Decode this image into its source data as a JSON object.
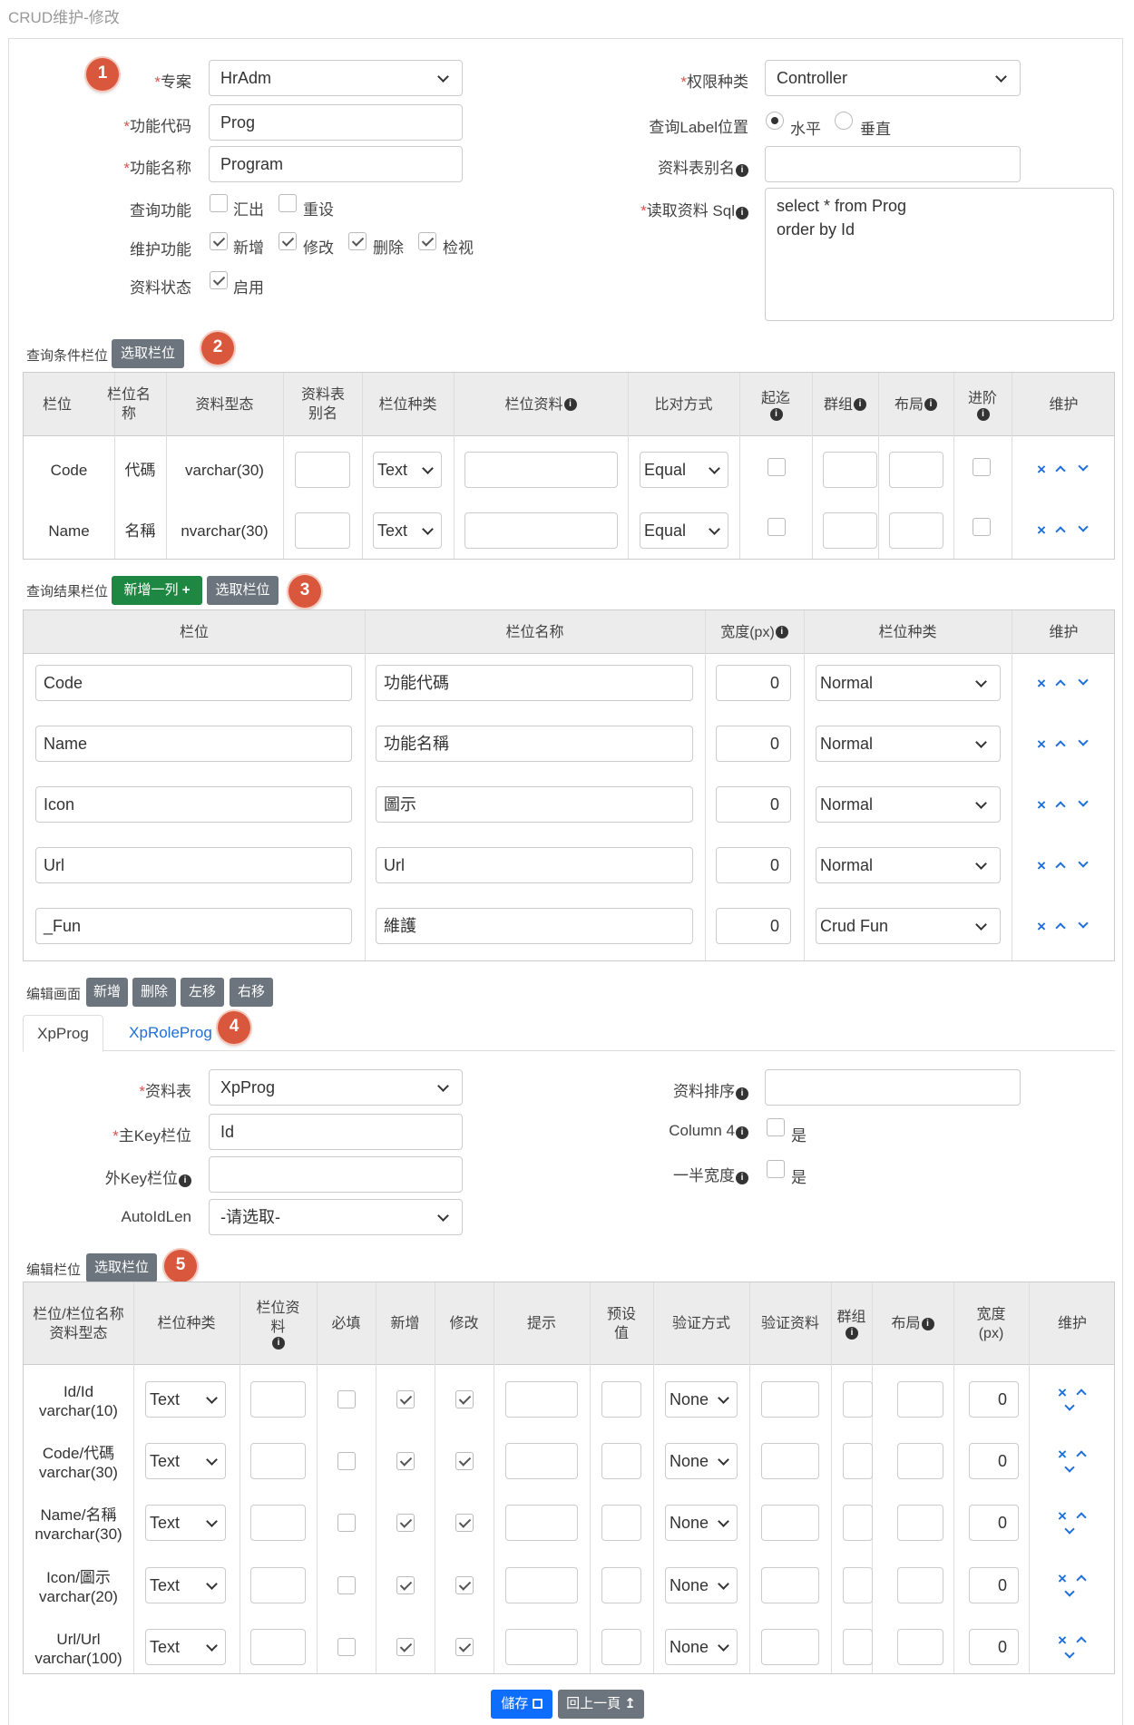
{
  "page_title": "CRUD维护-修改",
  "badges": [
    "1",
    "2",
    "3",
    "4",
    "5"
  ],
  "form": {
    "project": {
      "label": "专案",
      "value": "HrAdm"
    },
    "prog_code": {
      "label": "功能代码",
      "value": "Prog"
    },
    "prog_name": {
      "label": "功能名称",
      "value": "Program"
    },
    "query_func": {
      "label": "查询功能",
      "export": "汇出",
      "reset": "重设"
    },
    "maint_func": {
      "label": "维护功能",
      "add": "新增",
      "edit": "修改",
      "delete": "删除",
      "view": "检视"
    },
    "data_status": {
      "label": "资料状态",
      "enabled": "启用"
    },
    "auth_type": {
      "label": "权限种类",
      "value": "Controller"
    },
    "query_label_pos": {
      "label": "查询Label位置",
      "horizontal": "水平",
      "vertical": "垂直"
    },
    "table_alias": {
      "label": "资料表别名",
      "value": ""
    },
    "read_sql": {
      "label": "读取资料 Sql",
      "line1": "select * from Prog",
      "line2": "order by Id"
    }
  },
  "query_cond": {
    "label": "查询条件栏位",
    "pick_btn": "选取栏位",
    "headers": [
      "栏位",
      "栏位名称",
      "资料型态",
      "资料表别名",
      "栏位种类",
      "栏位资料",
      "比对方式",
      "起迄",
      "群组",
      "布局",
      "进阶",
      "维护"
    ],
    "rows": [
      {
        "field": "Code",
        "name": "代碼",
        "type": "varchar(30)",
        "kind": "Text",
        "op": "Equal"
      },
      {
        "field": "Name",
        "name": "名稱",
        "type": "nvarchar(30)",
        "kind": "Text",
        "op": "Equal"
      }
    ]
  },
  "query_result": {
    "label": "查询结果栏位",
    "add_btn": "新增一列",
    "pick_btn": "选取栏位",
    "headers": [
      "栏位",
      "栏位名称",
      "宽度(px)",
      "栏位种类",
      "维护"
    ],
    "rows": [
      {
        "field": "Code",
        "name": "功能代碼",
        "width": "0",
        "kind": "Normal"
      },
      {
        "field": "Name",
        "name": "功能名稱",
        "width": "0",
        "kind": "Normal"
      },
      {
        "field": "Icon",
        "name": "圖示",
        "width": "0",
        "kind": "Normal"
      },
      {
        "field": "Url",
        "name": "Url",
        "width": "0",
        "kind": "Normal"
      },
      {
        "field": "_Fun",
        "name": "維護",
        "width": "0",
        "kind": "Crud Fun"
      }
    ]
  },
  "edit_screen": {
    "label": "编辑画面",
    "add_btn": "新增",
    "delete_btn": "删除",
    "left_btn": "左移",
    "right_btn": "右移",
    "tabs": [
      "XpProg",
      "XpRoleProg"
    ],
    "table": {
      "label": "资料表",
      "value": "XpProg"
    },
    "pk": {
      "label": "主Key栏位",
      "value": "Id"
    },
    "fk": {
      "label": "外Key栏位",
      "value": ""
    },
    "auto_id": {
      "label": "AutoIdLen",
      "value": "-请选取-"
    },
    "sort": {
      "label": "资料排序",
      "value": ""
    },
    "col4": {
      "label": "Column 4",
      "yes": "是"
    },
    "half": {
      "label": "一半宽度",
      "yes": "是"
    }
  },
  "edit_fields": {
    "label": "编辑栏位",
    "pick_btn": "选取栏位",
    "headers": [
      "栏位/栏位名称",
      "资料型态",
      "栏位种类",
      "栏位资料",
      "必填",
      "新增",
      "修改",
      "提示",
      "预设值",
      "验证方式",
      "验证资料",
      "群组",
      "布局",
      "宽度(px)",
      "维护"
    ],
    "rows": [
      {
        "field": "Id/Id",
        "type": "varchar(10)",
        "kind": "Text",
        "valid": "None",
        "width": "0"
      },
      {
        "field": "Code/代碼",
        "type": "varchar(30)",
        "kind": "Text",
        "valid": "None",
        "width": "0"
      },
      {
        "field": "Name/名稱",
        "type": "nvarchar(30)",
        "kind": "Text",
        "valid": "None",
        "width": "0"
      },
      {
        "field": "Icon/圖示",
        "type": "varchar(20)",
        "kind": "Text",
        "valid": "None",
        "width": "0"
      },
      {
        "field": "Url/Url",
        "type": "varchar(100)",
        "kind": "Text",
        "valid": "None",
        "width": "0"
      }
    ]
  },
  "footer": {
    "save_btn": "儲存",
    "back_btn": "回上一頁"
  },
  "colors": {
    "badge": "#d9573c",
    "primary": "#0d6efd",
    "success": "#1e8741",
    "secondary": "#6c757d",
    "link": "#1e6fd9",
    "required": "#d9534f"
  },
  "icons": [
    "info-icon",
    "save-icon",
    "back-icon",
    "plus-icon",
    "delete-icon",
    "move-up-icon",
    "move-down-icon",
    "chevron-down-icon",
    "check-icon"
  ]
}
